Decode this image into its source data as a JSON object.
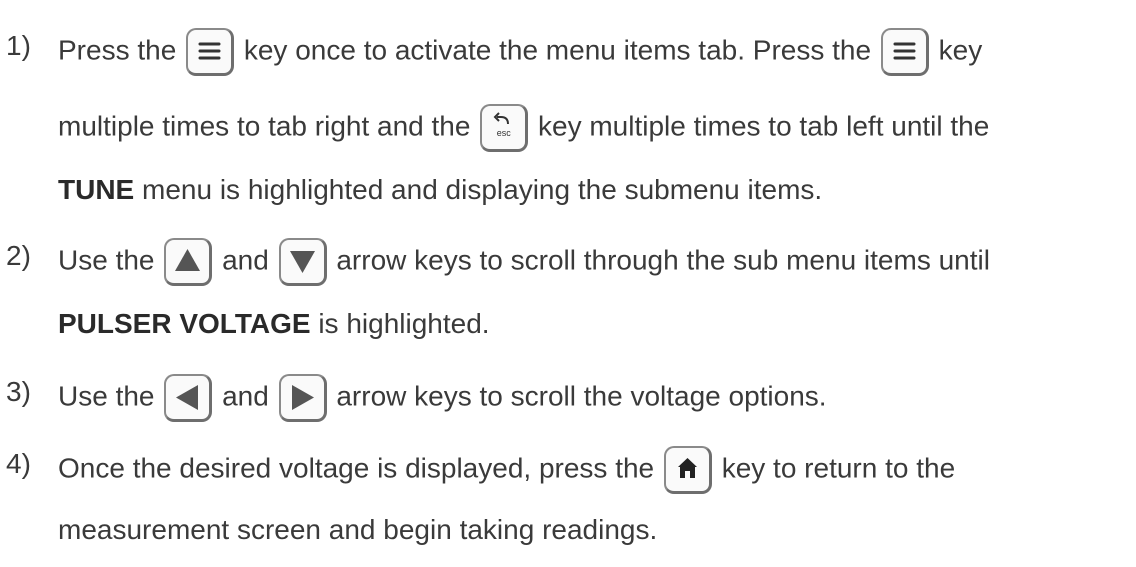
{
  "steps": [
    {
      "number": "1)",
      "lines": [
        {
          "a": "Press the ",
          "b": " key once to activate the menu items tab.  Press the ",
          "c": " key"
        },
        {
          "a": "multiple times to tab right and the ",
          "b": " key multiple times to tab left until the"
        },
        {
          "bold": "TUNE",
          "a": " menu is highlighted and displaying the submenu items."
        }
      ]
    },
    {
      "number": "2)",
      "lines": [
        {
          "a": "Use the ",
          "b": " and ",
          "c": " arrow keys to scroll through the sub menu items until"
        },
        {
          "bold": "PULSER VOLTAGE",
          "a": " is highlighted."
        }
      ]
    },
    {
      "number": "3)",
      "lines": [
        {
          "a": "Use the ",
          "b": " and ",
          "c": " arrow keys to scroll the voltage options."
        }
      ]
    },
    {
      "number": "4)",
      "lines": [
        {
          "a": "Once the desired voltage is displayed, press the ",
          "b": " key to return to the"
        },
        {
          "a": "measurement screen and begin taking readings."
        }
      ]
    }
  ],
  "keys": {
    "menu": "menu-icon",
    "esc": "esc-key-icon",
    "esc_label": "esc",
    "up": "up-arrow-icon",
    "down": "down-arrow-icon",
    "left": "left-arrow-icon",
    "right": "right-arrow-icon",
    "home": "home-icon"
  },
  "colors": {
    "text": "#3a3a3a",
    "key_border": "#6e6e6e",
    "icon": "#555555"
  }
}
